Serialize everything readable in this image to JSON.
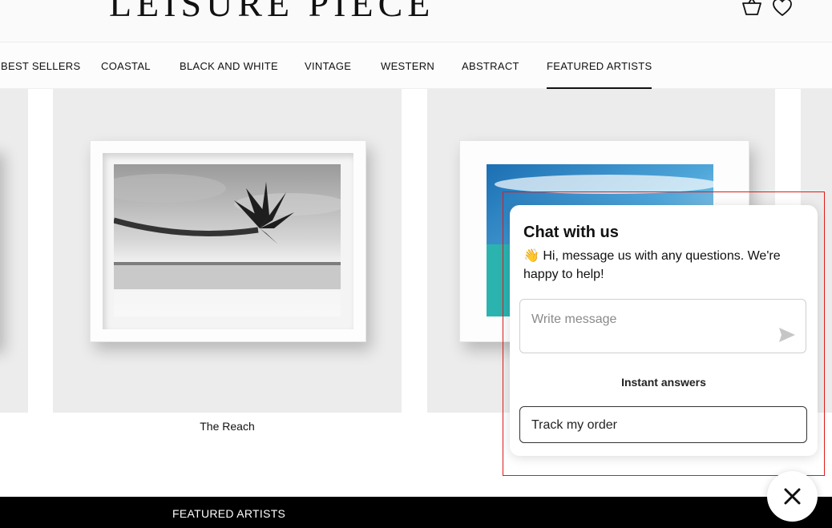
{
  "brand": {
    "logo_text": "LEISURE PIECE"
  },
  "header_icons": {
    "cart": "basket-icon",
    "wishlist": "heart-icon"
  },
  "nav": {
    "items": [
      {
        "label": "BEST SELLERS"
      },
      {
        "label": "COASTAL"
      },
      {
        "label": "BLACK AND WHITE"
      },
      {
        "label": "VINTAGE"
      },
      {
        "label": "WESTERN"
      },
      {
        "label": "ABSTRACT"
      },
      {
        "label": "FEATURED ARTISTS",
        "active": true
      }
    ]
  },
  "products": [
    {
      "title": "The Reach"
    }
  ],
  "footer": {
    "section_label": "FEATURED ARTISTS"
  },
  "chat": {
    "title": "Chat with us",
    "greeting_emoji": "👋",
    "greeting": "Hi, message us with any questions. We're happy to help!",
    "message_placeholder": "Write message",
    "instant_answers_heading": "Instant answers",
    "quick_replies": [
      {
        "label": "Track my order"
      }
    ],
    "highlight_color": "#e01b1b"
  }
}
